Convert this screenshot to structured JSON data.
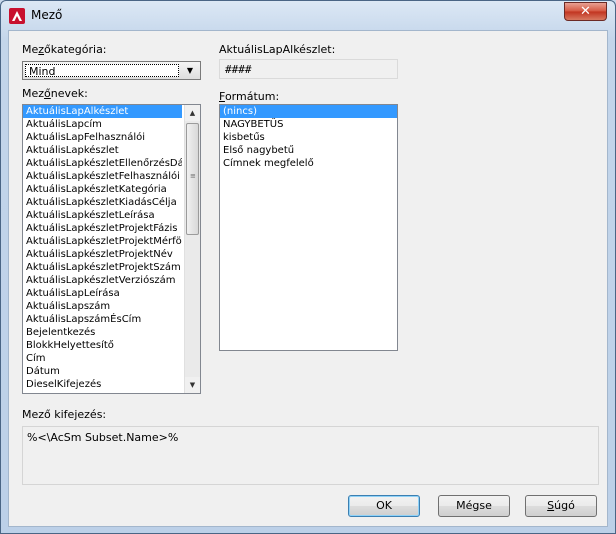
{
  "window": {
    "title": "Mező",
    "close_glyph": "✕"
  },
  "category": {
    "label_mnemonic": "z",
    "label_pre": "Me",
    "label_post": "őkategória:",
    "selected": "Mind"
  },
  "preview": {
    "label": "AktuálisLapAlkészlet:",
    "value": "####"
  },
  "field_names": {
    "label_pre": "Mez",
    "label_mnemonic": "ő",
    "label_post": "nevek:",
    "items": [
      "AktuálisLapAlkészlet",
      "AktuálisLapcím",
      "AktuálisLapFelhasználói",
      "AktuálisLapkészlet",
      "AktuálisLapkészletEllenőrzésDátu",
      "AktuálisLapkészletFelhasználói",
      "AktuálisLapkészletKategória",
      "AktuálisLapkészletKiadásCélja",
      "AktuálisLapkészletLeírása",
      "AktuálisLapkészletProjektFázis",
      "AktuálisLapkészletProjektMérföld",
      "AktuálisLapkészletProjektNév",
      "AktuálisLapkészletProjektSzám",
      "AktuálisLapkészletVerziószám",
      "AktuálisLapLeírása",
      "AktuálisLapszám",
      "AktuálisLapszámÉsCím",
      "Bejelentkezés",
      "BlokkHelyettesítő",
      "Cím",
      "Dátum",
      "DieselKifejezés"
    ],
    "selected_index": 0
  },
  "format": {
    "label_mnemonic": "F",
    "label_post": "ormátum:",
    "items": [
      "(nincs)",
      "NAGYBETŰS",
      "kisbetűs",
      "Első nagybetű",
      "Címnek megfelelő"
    ],
    "selected_index": 0
  },
  "expression": {
    "label": "Mező kifejezés:",
    "value": "%<\\AcSm Subset.Name>%"
  },
  "buttons": {
    "ok": "OK",
    "cancel": "Mégse",
    "help_mnemonic": "S",
    "help_post": "úgó"
  },
  "colors": {
    "selection": "#3399ff",
    "close_button": "#c1331f"
  }
}
